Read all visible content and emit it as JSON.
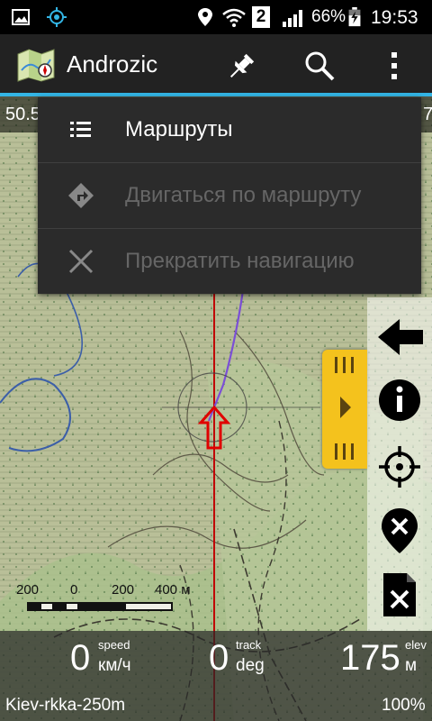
{
  "status_bar": {
    "battery_percent": "66%",
    "time": "19:53",
    "sim_badge": "2",
    "icons": [
      "image-icon",
      "gps-icon",
      "location-icon",
      "wifi-icon",
      "signal-icon",
      "battery-icon"
    ]
  },
  "action_bar": {
    "title": "Androzic",
    "icons": [
      "app-logo-icon",
      "pin-icon",
      "search-icon",
      "overflow-menu-icon"
    ]
  },
  "map": {
    "coord_left": "50.5",
    "coord_right": "7"
  },
  "menu": {
    "items": [
      {
        "label": "Маршруты",
        "icon": "list-icon",
        "enabled": true
      },
      {
        "label": "Двигаться по маршруту",
        "icon": "directions-icon",
        "enabled": false
      },
      {
        "label": "Прекратить навигацию",
        "icon": "close-icon",
        "enabled": false
      }
    ]
  },
  "side_buttons": [
    "arrow-left-icon",
    "info-icon",
    "crosshair-icon",
    "marker-remove-icon",
    "file-remove-icon"
  ],
  "scale": {
    "labels": [
      "200",
      "0",
      "200",
      "400 м"
    ]
  },
  "bottom": {
    "speed": {
      "value": "0",
      "label": "speed",
      "unit": "км/ч"
    },
    "track": {
      "value": "0",
      "label": "track",
      "unit": "deg"
    },
    "elev": {
      "value": "175",
      "label": "elev",
      "unit": "м"
    }
  },
  "footer": {
    "map_name": "Kiev-rkka-250m",
    "zoom": "100%"
  },
  "colors": {
    "accent": "#33b5e5",
    "slider": "#f4c21d",
    "route": "#7b4fd6",
    "track": "#c00000"
  }
}
